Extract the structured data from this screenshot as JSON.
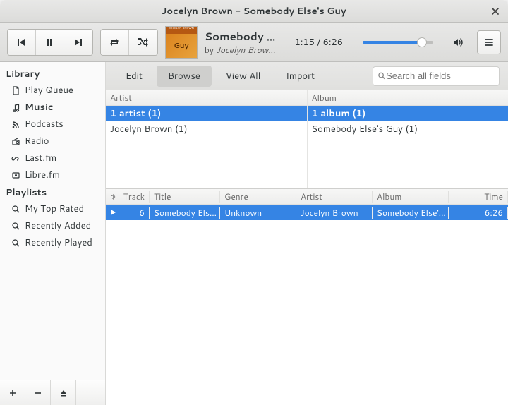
{
  "window": {
    "title": "Jocelyn Brown - Somebody Else's Guy"
  },
  "toolbar": {
    "now_playing_title": "Somebody El…",
    "now_playing_by_prefix": "by ",
    "now_playing_artist": "Jocelyn Brow…",
    "time": "-1:15 / 6:26"
  },
  "sidebar": {
    "library_label": "Library",
    "items": [
      {
        "label": "Play Queue"
      },
      {
        "label": "Music"
      },
      {
        "label": "Podcasts"
      },
      {
        "label": "Radio"
      },
      {
        "label": "Last.fm"
      },
      {
        "label": "Libre.fm"
      }
    ],
    "playlists_label": "Playlists",
    "playlists": [
      {
        "label": "My Top Rated"
      },
      {
        "label": "Recently Added"
      },
      {
        "label": "Recently Played"
      }
    ]
  },
  "tabs": {
    "edit": "Edit",
    "browse": "Browse",
    "viewall": "View All",
    "import": "Import"
  },
  "search": {
    "placeholder": "Search all fields"
  },
  "browser": {
    "artist_header": "Artist",
    "album_header": "Album",
    "artist_summary": "1 artist (1)",
    "album_summary": "1 album (1)",
    "artist_row": "Jocelyn Brown (1)",
    "album_row": "Somebody Else's Guy (1)"
  },
  "table": {
    "headers": {
      "track": "Track",
      "title": "Title",
      "genre": "Genre",
      "artist": "Artist",
      "album": "Album",
      "time": "Time"
    },
    "row": {
      "track": "6",
      "title": "Somebody Els…",
      "genre": "Unknown",
      "artist": "Jocelyn Brown",
      "album": "Somebody Else'…",
      "time": "6:26"
    }
  }
}
